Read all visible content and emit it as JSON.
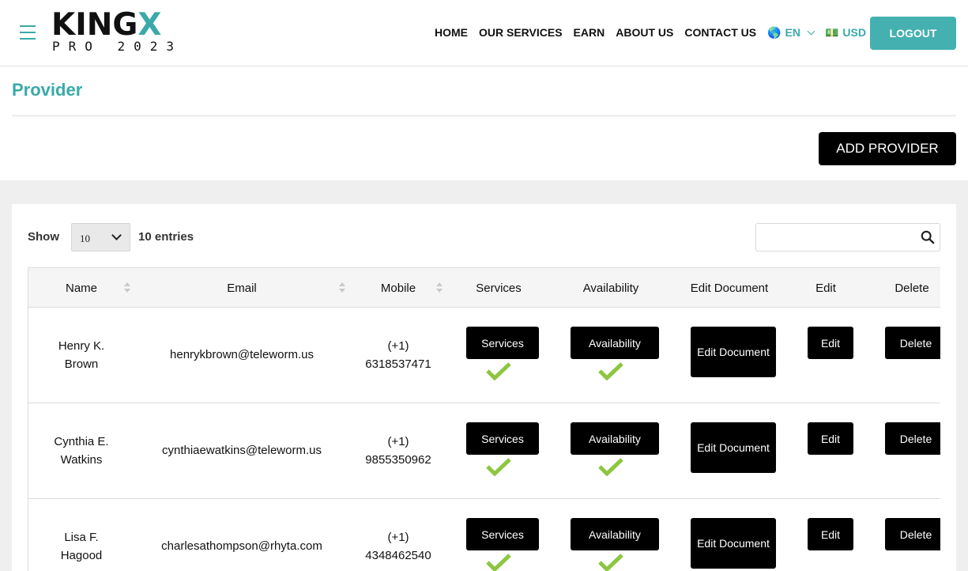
{
  "header": {
    "logo_main_a": "KING",
    "logo_main_b": "X",
    "logo_sub": "PRO 2023",
    "nav": [
      "HOME",
      "OUR SERVICES",
      "EARN",
      "ABOUT US",
      "CONTACT US"
    ],
    "language": {
      "flag": "🌎",
      "label": "EN"
    },
    "currency": {
      "flag": "💵",
      "label": "USD"
    },
    "logout_label": "LOGOUT"
  },
  "page": {
    "title": "Provider",
    "add_label": "ADD PROVIDER"
  },
  "table_controls": {
    "show_label": "Show",
    "length_value": "10",
    "entries_label": "10 entries",
    "search_value": ""
  },
  "table": {
    "columns": [
      "Name",
      "Email",
      "Mobile",
      "Services",
      "Availability",
      "Edit Document",
      "Edit",
      "Delete"
    ],
    "button_labels": {
      "services": "Services",
      "availability": "Availability",
      "edit_document": "Edit Document",
      "edit": "Edit",
      "delete": "Delete"
    },
    "rows": [
      {
        "name": "Henry K. Brown",
        "email": "henrykbrown@teleworm.us",
        "mobile": "(+1) 6318537471",
        "services_ok": true,
        "availability_ok": true
      },
      {
        "name": "Cynthia E. Watkins",
        "email": "cynthiaewatkins@teleworm.us",
        "mobile": "(+1) 9855350962",
        "services_ok": true,
        "availability_ok": true
      },
      {
        "name": "Lisa F. Hagood",
        "email": "charlesathompson@rhyta.com",
        "mobile": "(+1) 4348462540",
        "services_ok": true,
        "availability_ok": true
      }
    ]
  },
  "colors": {
    "accent": "#3aa9a9",
    "check": "#8cc63f",
    "button": "#000000",
    "band": "#efefef"
  }
}
